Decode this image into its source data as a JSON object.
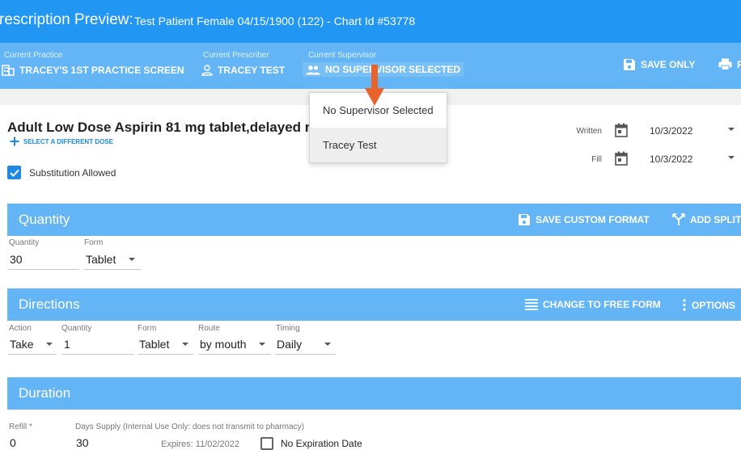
{
  "title_bar": {
    "title": "rescription Preview:",
    "patient_info": "Test Patient Female 04/15/1900 (122) - Chart Id #53778"
  },
  "context_bar": {
    "practice": {
      "label": "Current Practice",
      "value": "TRACEY'S 1ST PRACTICE SCREEN",
      "icon": "building-icon"
    },
    "prescriber": {
      "label": "Current Prescriber",
      "value": "TRACEY TEST",
      "icon": "person-icon"
    },
    "supervisor": {
      "label": "Current Supervisor",
      "value": "NO SUPERVISOR SELECTED",
      "icon": "people-icon"
    },
    "save_only_label": "SAVE ONLY",
    "print_label": "P"
  },
  "supervisor_dropdown": {
    "options": [
      "No Supervisor Selected",
      "Tracey Test"
    ],
    "hovered_index": 1
  },
  "drug": {
    "name": "Adult Low Dose Aspirin 81 mg tablet,delayed r",
    "select_dose_label": "SELECT A DIFFERENT DOSE",
    "substitution_label": "Substitution Allowed",
    "substitution_checked": true
  },
  "dates": {
    "written_label": "Written",
    "written_value": "10/3/2022",
    "fill_label": "Fill",
    "fill_value": "10/3/2022"
  },
  "quantity_section": {
    "title": "Quantity",
    "save_custom_format_label": "SAVE CUSTOM FORMAT",
    "add_split_label": "ADD SPLIT",
    "quantity_label": "Quantity",
    "quantity_value": "30",
    "form_label": "Form",
    "form_value": "Tablet"
  },
  "directions_section": {
    "title": "Directions",
    "change_free_form_label": "CHANGE TO FREE FORM",
    "options_label": "OPTIONS",
    "action_label": "Action",
    "action_value": "Take",
    "quantity_label": "Quantity",
    "quantity_value": "1",
    "form_label": "Form",
    "form_value": "Tablet",
    "route_label": "Route",
    "route_value": "by mouth",
    "timing_label": "Timing",
    "timing_value": "Daily"
  },
  "duration_section": {
    "title": "Duration",
    "refill_label": "Refill *",
    "refill_value": "0",
    "days_supply_label": "Days Supply (Internal Use Only: does not transmit to pharmacy)",
    "days_supply_value": "30",
    "expires_label": "Expires: 11/02/2022",
    "no_expiration_label": "No Expiration Date"
  },
  "colors": {
    "title_bar": "#2196f3",
    "context_bar": "#64b5f6",
    "accent": "#1e88e5",
    "annotation_arrow": "#e8622c"
  }
}
